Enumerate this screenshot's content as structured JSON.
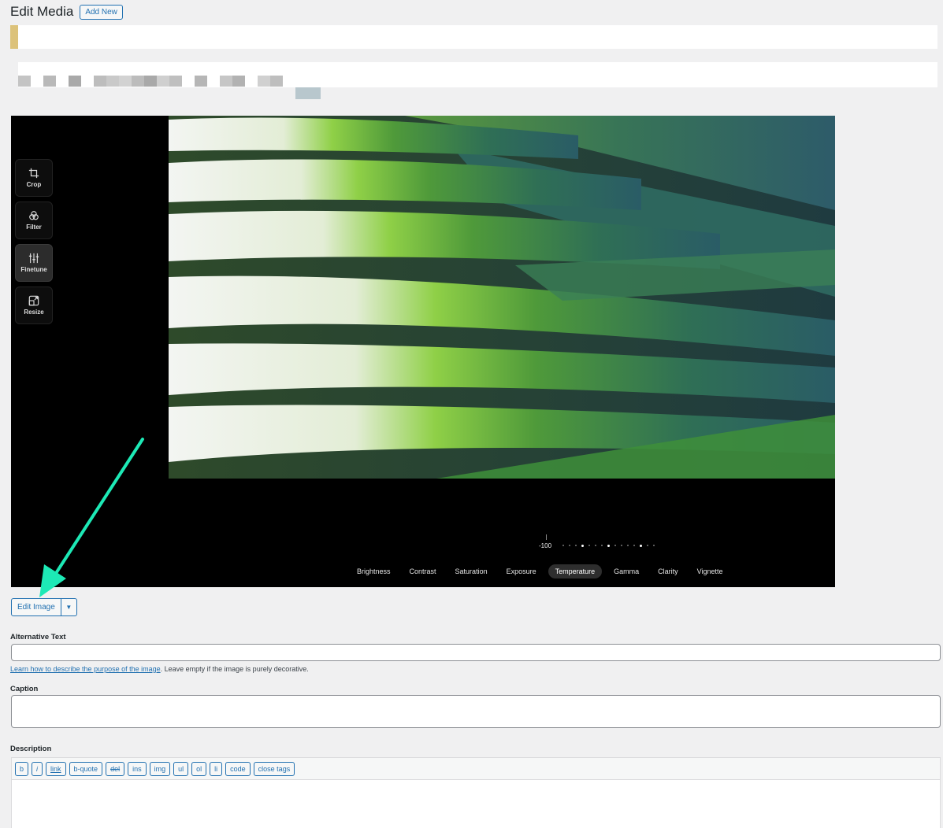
{
  "header": {
    "title": "Edit Media",
    "add_new_label": "Add New"
  },
  "editor": {
    "tools": [
      {
        "label": "Crop",
        "icon": "crop-icon"
      },
      {
        "label": "Filter",
        "icon": "filter-icon"
      },
      {
        "label": "Finetune",
        "icon": "finetune-icon",
        "active": true
      },
      {
        "label": "Resize",
        "icon": "resize-icon"
      }
    ],
    "slider_value": "-100",
    "adjust_tabs": [
      "Brightness",
      "Contrast",
      "Saturation",
      "Exposure",
      "Temperature",
      "Gamma",
      "Clarity",
      "Vignette"
    ],
    "active_tab": "Temperature"
  },
  "edit_image": {
    "label": "Edit Image",
    "caret": "▼"
  },
  "alt_text": {
    "label": "Alternative Text",
    "value": "",
    "help_link": "Learn how to describe the purpose of the image",
    "help_text": ". Leave empty if the image is purely decorative."
  },
  "caption": {
    "label": "Caption",
    "value": ""
  },
  "description": {
    "label": "Description",
    "quicktags": [
      "b",
      "i",
      "link",
      "b-quote",
      "del",
      "ins",
      "img",
      "ul",
      "ol",
      "li",
      "code",
      "close tags"
    ]
  },
  "colors": {
    "accent": "#2271b1",
    "arrow": "#1de9b6",
    "notice_border": "#dcc27a"
  }
}
